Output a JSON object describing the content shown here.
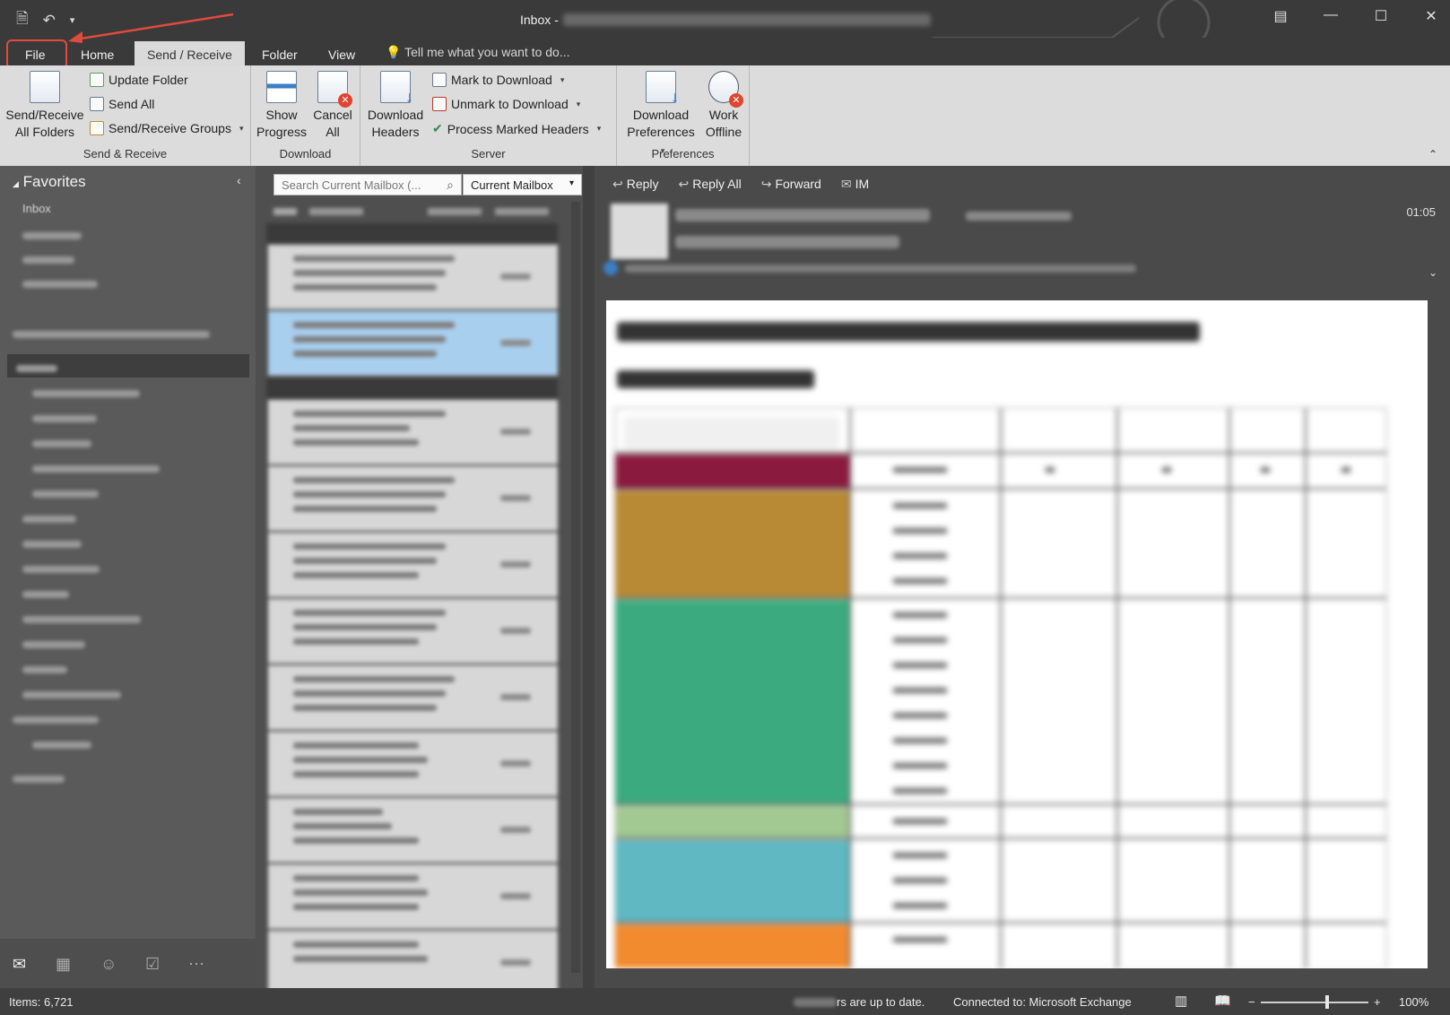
{
  "window": {
    "title_prefix": "Inbox -",
    "qat_icons": [
      "send-receive-icon",
      "undo-icon",
      "customize-icon"
    ]
  },
  "tabs": [
    {
      "label": "File"
    },
    {
      "label": "Home"
    },
    {
      "label": "Send / Receive"
    },
    {
      "label": "Folder"
    },
    {
      "label": "View"
    }
  ],
  "tell_me": "Tell me what you want to do...",
  "ribbon": {
    "send_receive": {
      "group_label": "Send & Receive",
      "send_receive_all": "Send/Receive All Folders",
      "update_folder": "Update Folder",
      "send_all": "Send All",
      "groups": "Send/Receive Groups"
    },
    "download": {
      "group_label": "Download",
      "show_progress": "Show Progress",
      "cancel_all": "Cancel All"
    },
    "server": {
      "group_label": "Server",
      "download_headers": "Download Headers",
      "mark_to_download": "Mark to Download",
      "unmark_to_download": "Unmark to Download",
      "process_marked_headers": "Process Marked Headers"
    },
    "preferences": {
      "group_label": "Preferences",
      "download_preferences": "Download Preferences",
      "work_offline": "Work Offline"
    }
  },
  "folders": {
    "favorites_label": "Favorites",
    "favorites_inbox": "Inbox"
  },
  "search": {
    "placeholder": "Search Current Mailbox (...",
    "scope": "Current Mailbox"
  },
  "reading": {
    "actions": {
      "reply": "Reply",
      "reply_all": "Reply All",
      "forward": "Forward",
      "im": "IM"
    },
    "time": "01:05"
  },
  "status": {
    "items": "Items: 6,721",
    "up_to_date": "rs are up to date.",
    "connection": "Connected to: Microsoft Exchange",
    "zoom": "100%",
    "zoom_level": 0.6
  },
  "colors": {
    "annotation": "#e14b3d",
    "selected_message": "#a9cfee",
    "row_maroon": "#8b1a3f",
    "row_ochre": "#b88a35",
    "row_green": "#3bab7f",
    "row_lightgreen": "#a2c992",
    "row_teal": "#5fb8c2",
    "row_orange": "#f28a2e"
  }
}
